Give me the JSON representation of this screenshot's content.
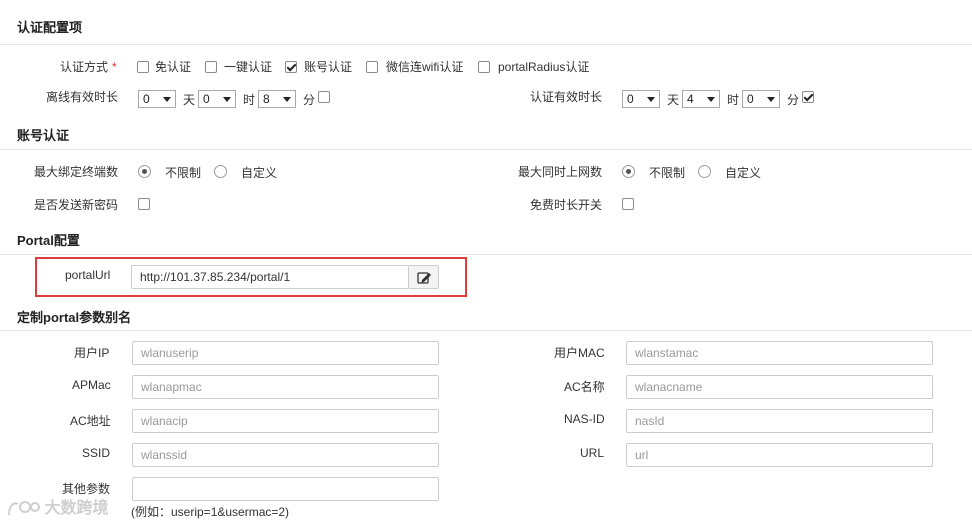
{
  "sections": {
    "auth_config": "认证配置项",
    "account_auth": "账号认证",
    "portal_config": "Portal配置",
    "custom_alias": "定制portal参数别名"
  },
  "auth_method": {
    "label": "认证方式",
    "required_mark": "*",
    "options": [
      {
        "label": "免认证",
        "checked": false
      },
      {
        "label": "一键认证",
        "checked": false
      },
      {
        "label": "账号认证",
        "checked": true
      },
      {
        "label": "微信连wifi认证",
        "checked": false
      },
      {
        "label": "portalRadius认证",
        "checked": false
      }
    ]
  },
  "offline_timeout": {
    "label": "离线有效时长",
    "day": "0",
    "day_unit": "天",
    "hour": "0",
    "hour_unit": "时",
    "minute": "8",
    "minute_unit": "分",
    "enabled": false
  },
  "auth_valid": {
    "label": "认证有效时长",
    "day": "0",
    "day_unit": "天",
    "hour": "4",
    "hour_unit": "时",
    "minute": "0",
    "minute_unit": "分",
    "enabled": true
  },
  "max_bind": {
    "label": "最大绑定终端数",
    "options": [
      {
        "label": "不限制",
        "selected": true
      },
      {
        "label": "自定义",
        "selected": false
      }
    ]
  },
  "max_online": {
    "label": "最大同时上网数",
    "options": [
      {
        "label": "不限制",
        "selected": true
      },
      {
        "label": "自定义",
        "selected": false
      }
    ]
  },
  "send_new_password": {
    "label": "是否发送新密码",
    "checked": false
  },
  "free_duration": {
    "label": "免费时长开关",
    "checked": false
  },
  "portal": {
    "label": "portalUrl",
    "value": "http://101.37.85.234/portal/1"
  },
  "aliases": {
    "user_ip": {
      "label": "用户IP",
      "placeholder": "wlanuserip"
    },
    "user_mac": {
      "label": "用户MAC",
      "placeholder": "wlanstamac"
    },
    "ap_mac": {
      "label": "APMac",
      "placeholder": "wlanapmac"
    },
    "ac_name": {
      "label": "AC名称",
      "placeholder": "wlanacname"
    },
    "ac_ip": {
      "label": "AC地址",
      "placeholder": "wlanacip"
    },
    "nas_id": {
      "label": "NAS-ID",
      "placeholder": "nasId"
    },
    "ssid": {
      "label": "SSID",
      "placeholder": "wlanssid"
    },
    "url": {
      "label": "URL",
      "placeholder": "url"
    },
    "other": {
      "label": "其他参数",
      "value": "",
      "hint": "(例如：userip=1&usermac=2)"
    }
  },
  "watermark": "大数跨境"
}
